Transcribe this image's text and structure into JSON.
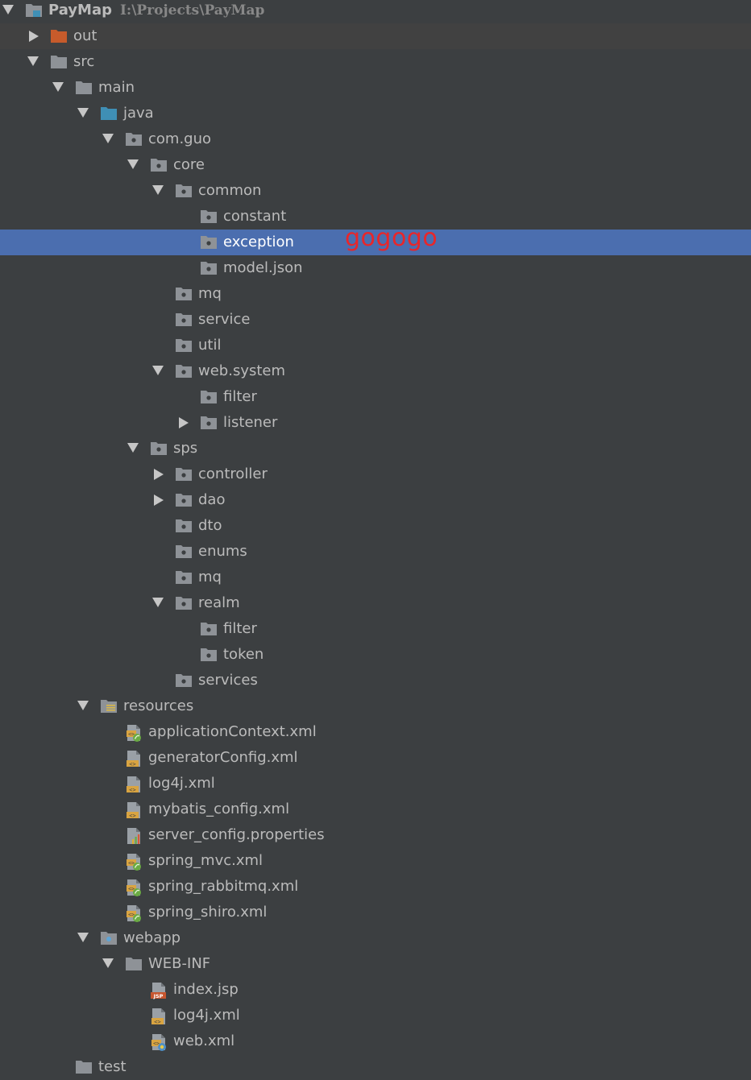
{
  "project": {
    "name": "PayMap",
    "path": "I:\\Projects\\PayMap"
  },
  "annotation": {
    "text": "gogogo",
    "color": "#e8262a"
  },
  "colors": {
    "background": "#3c3f41",
    "selection": "#4b6eaf",
    "folder": "#8e9297",
    "excluded_folder": "#c75b2b",
    "source_folder": "#3f8fb5",
    "text": "#bbbbbb"
  },
  "tree": [
    {
      "label": "PayMap",
      "path_text": "I:\\Projects\\PayMap",
      "depth": 0,
      "state": "open",
      "icon": "project-folder-icon"
    },
    {
      "label": "out",
      "depth": 1,
      "state": "closed",
      "icon": "excluded-folder-icon",
      "band": true
    },
    {
      "label": "src",
      "depth": 1,
      "state": "open",
      "icon": "folder-icon"
    },
    {
      "label": "main",
      "depth": 2,
      "state": "open",
      "icon": "folder-icon"
    },
    {
      "label": "java",
      "depth": 3,
      "state": "open",
      "icon": "source-folder-icon"
    },
    {
      "label": "com.guo",
      "depth": 4,
      "state": "open",
      "icon": "package-icon"
    },
    {
      "label": "core",
      "depth": 5,
      "state": "open",
      "icon": "package-icon"
    },
    {
      "label": "common",
      "depth": 6,
      "state": "open",
      "icon": "package-icon"
    },
    {
      "label": "constant",
      "depth": 7,
      "state": "leaf",
      "icon": "package-icon"
    },
    {
      "label": "exception",
      "depth": 7,
      "state": "leaf",
      "icon": "package-icon",
      "selected": true
    },
    {
      "label": "model.json",
      "depth": 7,
      "state": "leaf",
      "icon": "package-icon"
    },
    {
      "label": "mq",
      "depth": 6,
      "state": "leaf",
      "icon": "package-icon"
    },
    {
      "label": "service",
      "depth": 6,
      "state": "leaf",
      "icon": "package-icon"
    },
    {
      "label": "util",
      "depth": 6,
      "state": "leaf",
      "icon": "package-icon"
    },
    {
      "label": "web.system",
      "depth": 6,
      "state": "open",
      "icon": "package-icon"
    },
    {
      "label": "filter",
      "depth": 7,
      "state": "leaf",
      "icon": "package-icon"
    },
    {
      "label": "listener",
      "depth": 7,
      "state": "closed",
      "icon": "package-icon"
    },
    {
      "label": "sps",
      "depth": 5,
      "state": "open",
      "icon": "package-icon"
    },
    {
      "label": "controller",
      "depth": 6,
      "state": "closed",
      "icon": "package-icon"
    },
    {
      "label": "dao",
      "depth": 6,
      "state": "closed",
      "icon": "package-icon"
    },
    {
      "label": "dto",
      "depth": 6,
      "state": "leaf",
      "icon": "package-icon"
    },
    {
      "label": "enums",
      "depth": 6,
      "state": "leaf",
      "icon": "package-icon"
    },
    {
      "label": "mq",
      "depth": 6,
      "state": "leaf",
      "icon": "package-icon"
    },
    {
      "label": "realm",
      "depth": 6,
      "state": "open",
      "icon": "package-icon"
    },
    {
      "label": "filter",
      "depth": 7,
      "state": "leaf",
      "icon": "package-icon"
    },
    {
      "label": "token",
      "depth": 7,
      "state": "leaf",
      "icon": "package-icon"
    },
    {
      "label": "services",
      "depth": 6,
      "state": "leaf",
      "icon": "package-icon"
    },
    {
      "label": "resources",
      "depth": 3,
      "state": "open",
      "icon": "resources-folder-icon"
    },
    {
      "label": "applicationContext.xml",
      "depth": 4,
      "state": "leaf",
      "icon": "spring-xml-icon"
    },
    {
      "label": "generatorConfig.xml",
      "depth": 4,
      "state": "leaf",
      "icon": "xml-file-icon"
    },
    {
      "label": "log4j.xml",
      "depth": 4,
      "state": "leaf",
      "icon": "xml-file-icon"
    },
    {
      "label": "mybatis_config.xml",
      "depth": 4,
      "state": "leaf",
      "icon": "xml-file-icon"
    },
    {
      "label": "server_config.properties",
      "depth": 4,
      "state": "leaf",
      "icon": "properties-file-icon"
    },
    {
      "label": "spring_mvc.xml",
      "depth": 4,
      "state": "leaf",
      "icon": "spring-xml-icon"
    },
    {
      "label": "spring_rabbitmq.xml",
      "depth": 4,
      "state": "leaf",
      "icon": "spring-xml-icon"
    },
    {
      "label": "spring_shiro.xml",
      "depth": 4,
      "state": "leaf",
      "icon": "spring-xml-icon"
    },
    {
      "label": "webapp",
      "depth": 3,
      "state": "open",
      "icon": "web-folder-icon"
    },
    {
      "label": "WEB-INF",
      "depth": 4,
      "state": "open",
      "icon": "folder-icon"
    },
    {
      "label": "index.jsp",
      "depth": 5,
      "state": "leaf",
      "icon": "jsp-file-icon"
    },
    {
      "label": "log4j.xml",
      "depth": 5,
      "state": "leaf",
      "icon": "xml-file-icon"
    },
    {
      "label": "web.xml",
      "depth": 5,
      "state": "leaf",
      "icon": "web-xml-icon"
    },
    {
      "label": "test",
      "depth": 2,
      "state": "leaf",
      "icon": "folder-icon"
    }
  ]
}
